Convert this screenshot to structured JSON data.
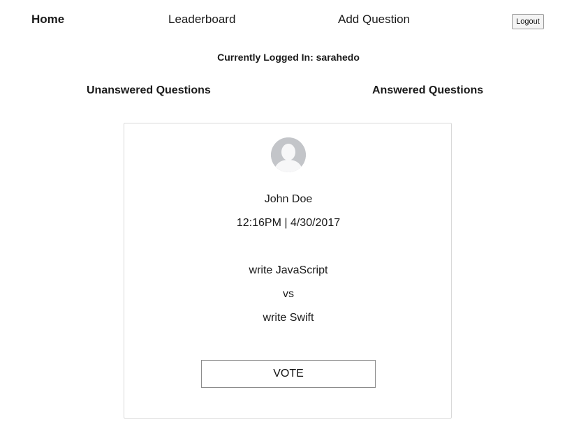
{
  "nav": {
    "home": "Home",
    "leaderboard": "Leaderboard",
    "add_question": "Add Question",
    "logout": "Logout"
  },
  "session": {
    "logged_in_text": "Currently Logged In: sarahedo"
  },
  "tabs": {
    "unanswered": "Unanswered Questions",
    "answered": "Answered Questions"
  },
  "question": {
    "avatar_icon": "user-silhouette-icon",
    "author": "John Doe",
    "timestamp": "12:16PM | 4/30/2017",
    "option_one": "write JavaScript",
    "separator": "vs",
    "option_two": "write Swift",
    "vote_label": "VOTE"
  }
}
